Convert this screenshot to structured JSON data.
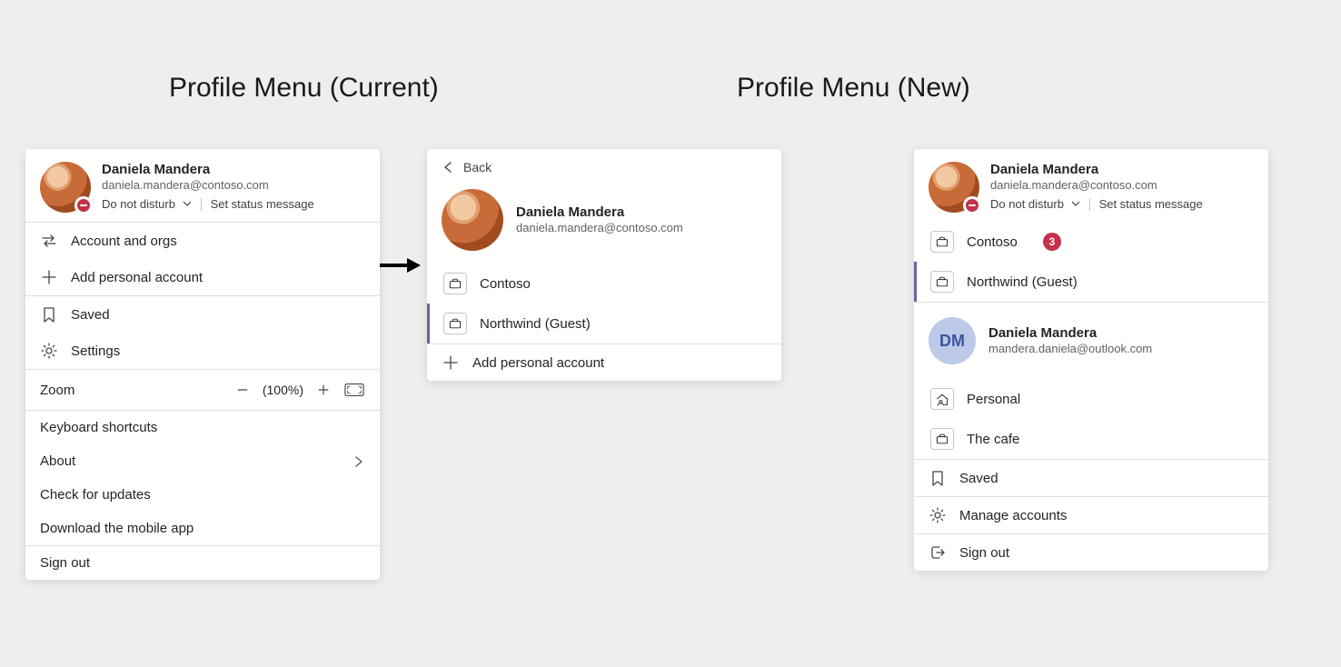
{
  "headings": {
    "current": "Profile Menu (Current)",
    "new": "Profile Menu (New)"
  },
  "user": {
    "name": "Daniela Mandera",
    "email": "daniela.mandera@contoso.com",
    "presence": "Do not disturb",
    "set_status_label": "Set status message"
  },
  "current_menu": {
    "accounts_orgs": "Account and orgs",
    "add_personal": "Add personal account",
    "saved": "Saved",
    "settings": "Settings",
    "zoom_label": "Zoom",
    "zoom_pct": "(100%)",
    "keyboard_shortcuts": "Keyboard shortcuts",
    "about": "About",
    "check_updates": "Check for updates",
    "download_app": "Download the mobile app",
    "sign_out": "Sign out"
  },
  "orgs_panel": {
    "back": "Back",
    "name": "Daniela Mandera",
    "email": "daniela.mandera@contoso.com",
    "orgs": [
      {
        "label": "Contoso",
        "selected": false
      },
      {
        "label": "Northwind (Guest)",
        "selected": true
      }
    ],
    "add_personal": "Add personal account"
  },
  "new_menu": {
    "orgs": [
      {
        "label": "Contoso",
        "badge": "3",
        "selected": false
      },
      {
        "label": "Northwind (Guest)",
        "selected": true
      }
    ],
    "second_account": {
      "initials": "DM",
      "name": "Daniela Mandera",
      "email": "mandera.daniela@outlook.com"
    },
    "second_orgs": [
      {
        "label": "Personal"
      },
      {
        "label": "The cafe"
      }
    ],
    "saved": "Saved",
    "manage_accounts": "Manage accounts",
    "sign_out": "Sign out"
  }
}
